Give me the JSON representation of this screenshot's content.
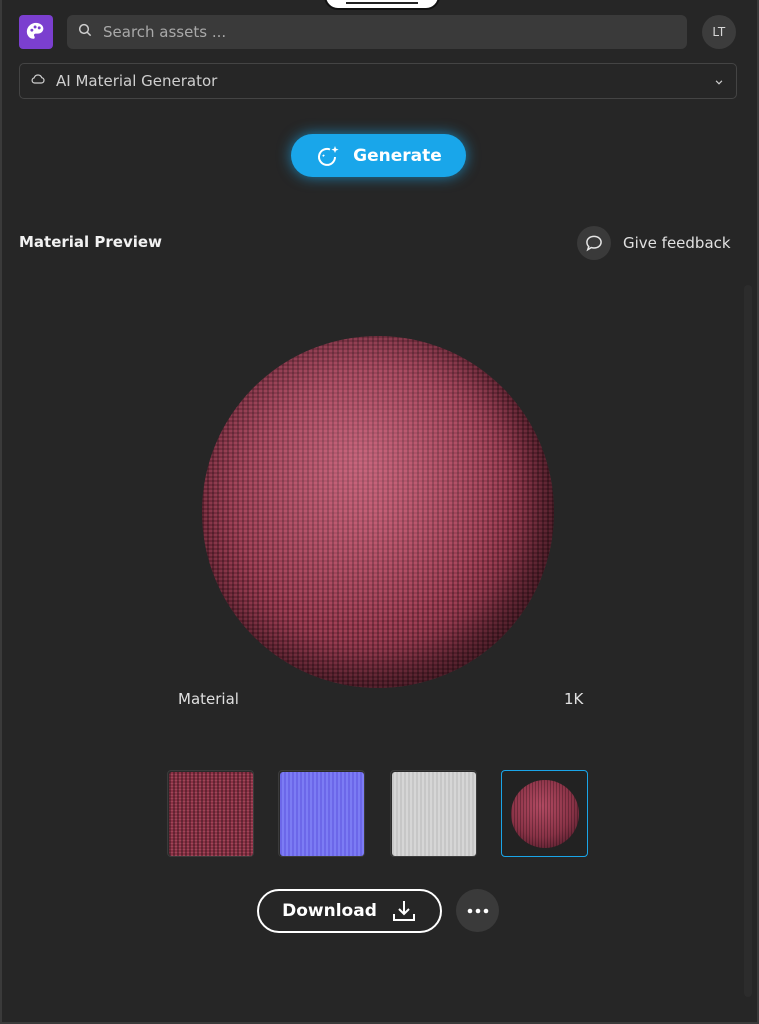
{
  "header": {
    "search_placeholder": "Search assets ...",
    "avatar_initials": "LT"
  },
  "generator": {
    "selected": "AI Material Generator"
  },
  "actions": {
    "generate_label": "Generate",
    "download_label": "Download"
  },
  "preview": {
    "title": "Material Preview",
    "feedback_label": "Give feedback",
    "material_label": "Material",
    "resolution_label": "1K",
    "thumbnails": [
      "albedo-map",
      "normal-map",
      "roughness-map",
      "sphere-preview"
    ],
    "selected_thumbnail": 3
  },
  "colors": {
    "accent": "#19a6ea",
    "logo": "#7b3fcf",
    "material": "#8c3246",
    "background": "#262626"
  },
  "icons": [
    "palette-logo-icon",
    "search-icon",
    "cloud-icon",
    "chevron-down-icon",
    "sparkle-refresh-icon",
    "chat-bubble-icon",
    "download-icon",
    "more-horizontal-icon"
  ]
}
